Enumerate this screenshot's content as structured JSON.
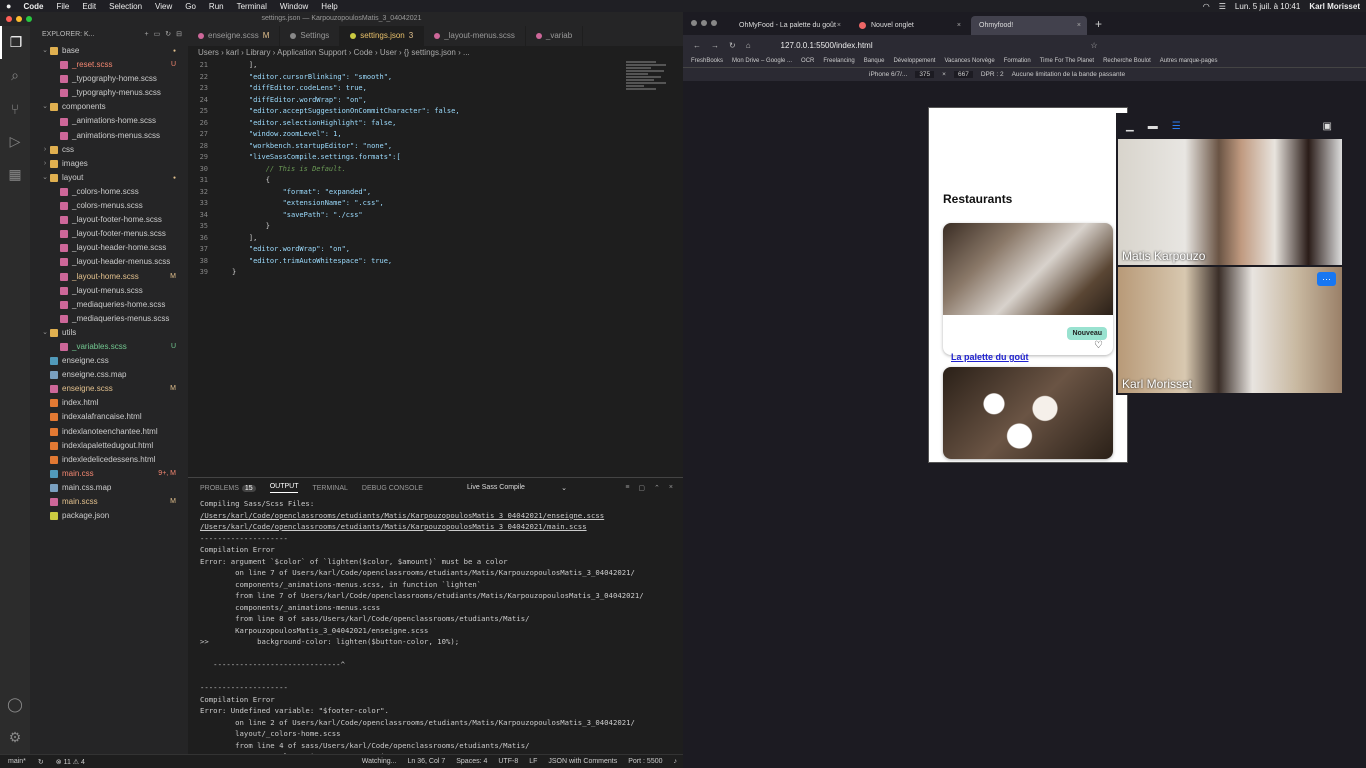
{
  "menubar": {
    "apple": "",
    "app": "Code",
    "items": [
      "File",
      "Edit",
      "Selection",
      "View",
      "Go",
      "Run",
      "Terminal",
      "Window",
      "Help"
    ],
    "datetime": "Lun. 5 juil. à 10:41",
    "user": "Karl Morisset"
  },
  "vscode": {
    "window_title": "settings.json — KarpouzopoulosMatis_3_04042021",
    "explorer_title": "EXPLORER: K...",
    "tree": [
      {
        "label": "base",
        "type": "folder",
        "indent": 1,
        "open": true,
        "status": "dot"
      },
      {
        "label": "_reset.scss",
        "type": "scss",
        "indent": 2,
        "status": "U",
        "color": "err"
      },
      {
        "label": "_typography-home.scss",
        "type": "scss",
        "indent": 2
      },
      {
        "label": "_typography-menus.scss",
        "type": "scss",
        "indent": 2
      },
      {
        "label": "components",
        "type": "folder",
        "indent": 1,
        "open": true
      },
      {
        "label": "_animations-home.scss",
        "type": "scss",
        "indent": 2
      },
      {
        "label": "_animations-menus.scss",
        "type": "scss",
        "indent": 2
      },
      {
        "label": "css",
        "type": "folder",
        "indent": 1,
        "open": false
      },
      {
        "label": "images",
        "type": "folder",
        "indent": 1,
        "open": false
      },
      {
        "label": "layout",
        "type": "folder",
        "indent": 1,
        "open": true,
        "status": "dot"
      },
      {
        "label": "_colors-home.scss",
        "type": "scss",
        "indent": 2
      },
      {
        "label": "_colors-menus.scss",
        "type": "scss",
        "indent": 2
      },
      {
        "label": "_layout-footer-home.scss",
        "type": "scss",
        "indent": 2
      },
      {
        "label": "_layout-footer-menus.scss",
        "type": "scss",
        "indent": 2
      },
      {
        "label": "_layout-header-home.scss",
        "type": "scss",
        "indent": 2
      },
      {
        "label": "_layout-header-menus.scss",
        "type": "scss",
        "indent": 2
      },
      {
        "label": "_layout-home.scss",
        "type": "scss",
        "indent": 2,
        "status": "M",
        "color": "mod"
      },
      {
        "label": "_layout-menus.scss",
        "type": "scss",
        "indent": 2
      },
      {
        "label": "_mediaqueries-home.scss",
        "type": "scss",
        "indent": 2
      },
      {
        "label": "_mediaqueries-menus.scss",
        "type": "scss",
        "indent": 2
      },
      {
        "label": "utils",
        "type": "folder",
        "indent": 1,
        "open": true
      },
      {
        "label": "_variables.scss",
        "type": "scss",
        "indent": 2,
        "status": "U",
        "color": "unt"
      },
      {
        "label": "enseigne.css",
        "type": "css",
        "indent": 1
      },
      {
        "label": "enseigne.css.map",
        "type": "map",
        "indent": 1
      },
      {
        "label": "enseigne.scss",
        "type": "scss",
        "indent": 1,
        "status": "M",
        "color": "mod"
      },
      {
        "label": "index.html",
        "type": "html",
        "indent": 1
      },
      {
        "label": "indexalafrancaise.html",
        "type": "html",
        "indent": 1
      },
      {
        "label": "indexlanoteenchantee.html",
        "type": "html",
        "indent": 1
      },
      {
        "label": "indexlapalettedugout.html",
        "type": "html",
        "indent": 1
      },
      {
        "label": "indexledelicedessens.html",
        "type": "html",
        "indent": 1
      },
      {
        "label": "main.css",
        "type": "css",
        "indent": 1,
        "status": "9+, M",
        "color": "err"
      },
      {
        "label": "main.css.map",
        "type": "map",
        "indent": 1
      },
      {
        "label": "main.scss",
        "type": "scss",
        "indent": 1,
        "status": "M",
        "color": "mod"
      },
      {
        "label": "package.json",
        "type": "json",
        "indent": 1
      }
    ],
    "tabs": [
      {
        "label": "enseigne.scss",
        "suffix": "M",
        "active": false,
        "color": "#cd6799"
      },
      {
        "label": "Settings",
        "suffix": "",
        "active": false,
        "color": "#888"
      },
      {
        "label": "settings.json",
        "suffix": "3",
        "active": true,
        "color": "#cbcb41"
      },
      {
        "label": "_layout-menus.scss",
        "suffix": "",
        "active": false,
        "color": "#cd6799"
      },
      {
        "label": "_variab",
        "suffix": "",
        "active": false,
        "color": "#cd6799"
      }
    ],
    "breadcrumb": "Users › karl › Library › Application Support › Code › User › {} settings.json › ...",
    "code": [
      {
        "n": "21",
        "t": "    ],"
      },
      {
        "n": "22",
        "t": "    \"editor.cursorBlinking\": \"smooth\","
      },
      {
        "n": "23",
        "t": "    \"diffEditor.codeLens\": true,"
      },
      {
        "n": "24",
        "t": "    \"diffEditor.wordWrap\": \"on\","
      },
      {
        "n": "25",
        "t": "    \"editor.acceptSuggestionOnCommitCharacter\": false,"
      },
      {
        "n": "26",
        "t": "    \"editor.selectionHighlight\": false,"
      },
      {
        "n": "27",
        "t": "    \"window.zoomLevel\": 1,"
      },
      {
        "n": "28",
        "t": "    \"workbench.startupEditor\": \"none\","
      },
      {
        "n": "29",
        "t": "    \"liveSassCompile.settings.formats\":["
      },
      {
        "n": "30",
        "t": "        // This is Default."
      },
      {
        "n": "31",
        "t": "        {"
      },
      {
        "n": "32",
        "t": "            \"format\": \"expanded\","
      },
      {
        "n": "33",
        "t": "            \"extensionName\": \".css\","
      },
      {
        "n": "34",
        "t": "            \"savePath\": \"./css\""
      },
      {
        "n": "35",
        "t": "        }"
      },
      {
        "n": "36",
        "t": "    ],"
      },
      {
        "n": "37",
        "t": "    \"editor.wordWrap\": \"on\","
      },
      {
        "n": "38",
        "t": "    \"editor.trimAutoWhitespace\": true,"
      },
      {
        "n": "39",
        "t": "}"
      }
    ],
    "panel": {
      "tabs": [
        "PROBLEMS",
        "OUTPUT",
        "TERMINAL",
        "DEBUG CONSOLE"
      ],
      "problem_count": "15",
      "channel": "Live Sass Compile",
      "lines": [
        {
          "t": "Compiling Sass/Scss Files:"
        },
        {
          "t": "/Users/karl/Code/openclassrooms/etudiants/Matis/KarpouzopoulosMatis_3_04042021/enseigne.scss",
          "u": true
        },
        {
          "t": "/Users/karl/Code/openclassrooms/etudiants/Matis/KarpouzopoulosMatis_3_04042021/main.scss",
          "u": true
        },
        {
          "t": "--------------------"
        },
        {
          "t": "Compilation Error"
        },
        {
          "t": "Error: argument `$color` of `lighten($color, $amount)` must be a color"
        },
        {
          "t": "        on line 7 of Users/karl/Code/openclassrooms/etudiants/Matis/KarpouzopoulosMatis_3_04042021/"
        },
        {
          "t": "        components/_animations-menus.scss, in function `lighten`"
        },
        {
          "t": "        from line 7 of Users/karl/Code/openclassrooms/etudiants/Matis/KarpouzopoulosMatis_3_04042021/"
        },
        {
          "t": "        components/_animations-menus.scss"
        },
        {
          "t": "        from line 8 of sass/Users/karl/Code/openclassrooms/etudiants/Matis/"
        },
        {
          "t": "        KarpouzopoulosMatis_3_04042021/enseigne.scss"
        },
        {
          "t": ">>           background-color: lighten($button-color, 10%);"
        },
        {
          "t": ""
        },
        {
          "t": "   -----------------------------^"
        },
        {
          "t": ""
        },
        {
          "t": "--------------------"
        },
        {
          "t": "Compilation Error"
        },
        {
          "t": "Error: Undefined variable: \"$footer-color\"."
        },
        {
          "t": "        on line 2 of Users/karl/Code/openclassrooms/etudiants/Matis/KarpouzopoulosMatis_3_04042021/"
        },
        {
          "t": "        layout/_colors-home.scss"
        },
        {
          "t": "        from line 4 of sass/Users/karl/Code/openclassrooms/etudiants/Matis/"
        },
        {
          "t": "        KarpouzopoulosMatis_3_04042021/main.scss"
        }
      ]
    },
    "status": {
      "branch": "main*",
      "errors": "⊗ 11 ⚠ 4",
      "watching": "Watching...",
      "position": "Ln 36, Col 7",
      "spaces": "Spaces: 4",
      "encoding": "UTF-8",
      "eol": "LF",
      "language": "JSON with Comments",
      "port": "Port : 5500"
    }
  },
  "browser": {
    "tabs": [
      {
        "label": "OhMyFood - La palette du goût",
        "active": false
      },
      {
        "label": "Nouvel onglet",
        "active": false
      },
      {
        "label": "Ohmyfood!",
        "active": true
      }
    ],
    "url": "127.0.0.1:5500/index.html",
    "bookmarks": [
      "FreshBooks",
      "Mon Drive – Google ...",
      "OCR",
      "Freelancing",
      "Banque",
      "Développement",
      "Vacances Norvège",
      "Formation",
      "Time For The Planet",
      "Recherche Boulot",
      "Autres marque-pages"
    ],
    "rdm": {
      "device": "iPhone 6/7/...",
      "width": "375",
      "height": "667",
      "dpr": "DPR : 2",
      "throttle": "Aucune limitation de la bande passante"
    },
    "page": {
      "title": "Restaurants",
      "badge": "Nouveau",
      "card_label": "La palette du goût"
    }
  },
  "call": {
    "participants": [
      {
        "name": "Matis Karpouzo"
      },
      {
        "name": "Karl Morisset"
      }
    ],
    "more": "···"
  }
}
